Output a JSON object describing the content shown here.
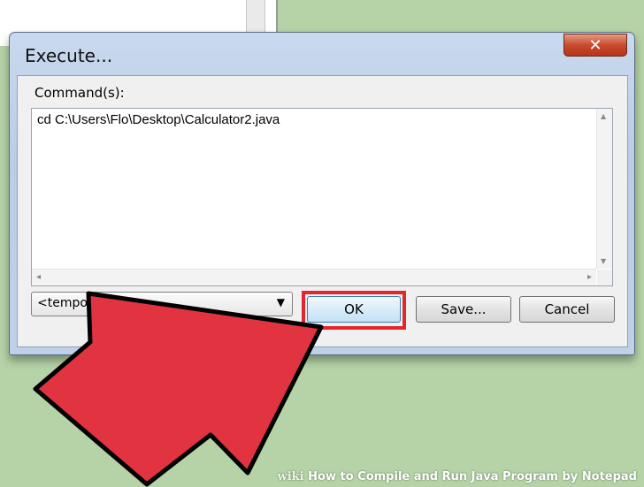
{
  "dialog": {
    "title": "Execute...",
    "close_glyph": "✕",
    "commands_label": "Command(s):",
    "command_text": "cd C:\\Users\\Flo\\Desktop\\Calculator2.java",
    "template_value": "<tempo",
    "ok_label": "OK",
    "save_label": "Save...",
    "cancel_label": "Cancel"
  },
  "icons": {
    "close": "close-icon",
    "dropdown": "chevron-down-icon",
    "scroll_up": "arrow-up-icon",
    "scroll_down": "arrow-down-icon",
    "scroll_left": "arrow-left-icon",
    "scroll_right": "arrow-right-icon",
    "pointer": "red-arrow-pointer"
  },
  "colors": {
    "background": "#b5d3a7",
    "highlight": "#e3262d",
    "arrow_fill": "#e23340",
    "close_button": "#c94a2c"
  },
  "watermark": {
    "brand": "wiki",
    "text": "How to Compile and Run Java Program by Notepad"
  }
}
